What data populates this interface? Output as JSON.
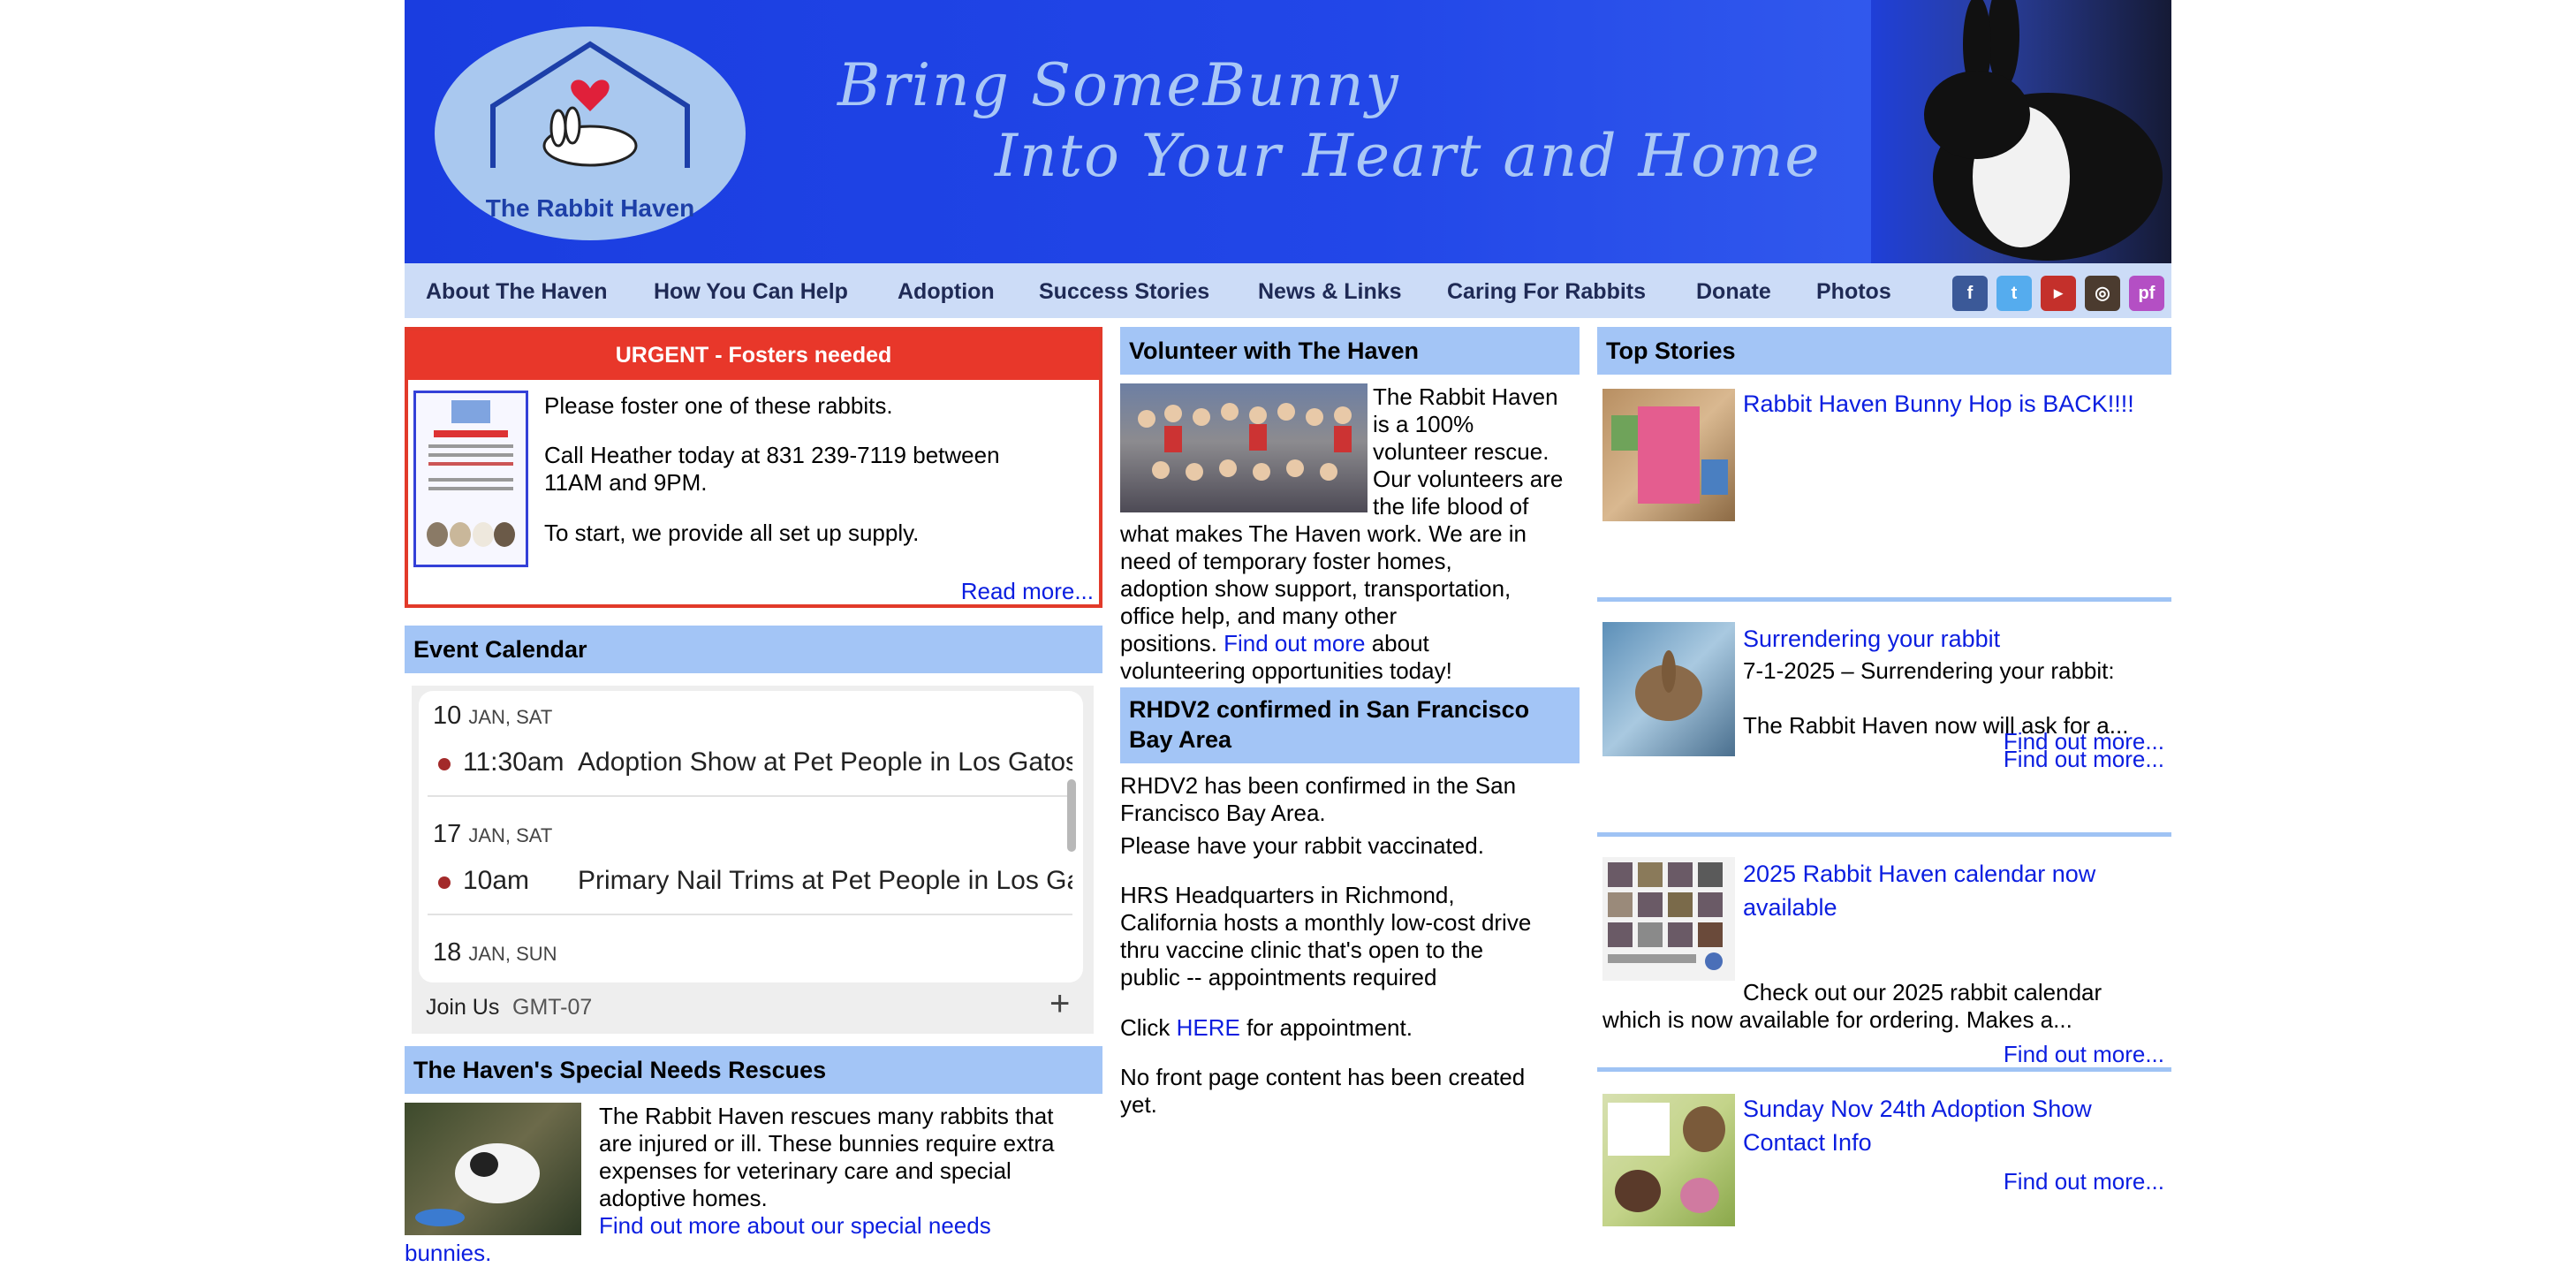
{
  "banner": {
    "logo_text": "The Rabbit Haven",
    "tagline_line1": "Bring SomeBunny",
    "tagline_line2": "Into Your Heart and Home"
  },
  "nav": {
    "items": [
      "About The Haven",
      "How You Can Help",
      "Adoption",
      "Success Stories",
      "News & Links",
      "Caring For Rabbits",
      "Donate",
      "Photos"
    ],
    "social": [
      "facebook-icon",
      "twitter-icon",
      "youtube-icon",
      "instagram-icon",
      "petfinder-icon"
    ]
  },
  "urgent": {
    "heading": "URGENT - Fosters needed",
    "p1": "Please foster one of these rabbits.",
    "p2a": "Call Heather today at 831 239-7119 between",
    "p2b": "11AM and 9PM.",
    "p3": "To start, we provide all set up supply.",
    "read_more": "Read more..."
  },
  "calendar": {
    "heading": "Event Calendar",
    "days": [
      {
        "day": "10",
        "dow": "JAN, SAT",
        "time": "11:30am",
        "title": "Adoption Show at Pet People in Los Gatos"
      },
      {
        "day": "17",
        "dow": "JAN, SAT",
        "time": "10am",
        "title": "Primary Nail Trims at Pet People in Los Gatos"
      },
      {
        "day": "18",
        "dow": "JAN, SUN"
      }
    ],
    "footer_label": "Join Us",
    "timezone": "GMT-07",
    "add_symbol": "+"
  },
  "special_needs": {
    "heading": "The Haven's Special Needs Rescues",
    "lines": [
      "The Rabbit Haven rescues many rabbits that",
      "are injured or ill. These bunnies require extra",
      "expenses for veterinary care and special",
      "adoptive homes."
    ],
    "link_part1": "Find out more about our special needs",
    "link_part2": "bunnies."
  },
  "volunteer": {
    "heading": "Volunteer with The Haven",
    "side_lines": [
      "The Rabbit Haven",
      "is a 100%",
      "volunteer rescue.",
      "Our volunteers are",
      "the life blood of"
    ],
    "full_lines": [
      "what makes The Haven work. We are in",
      "need of temporary foster homes,",
      "adoption show support, transportation,",
      "office help, and many other"
    ],
    "positions_prefix": "positions.",
    "find_out_more": "Find out more",
    "about_text": "about",
    "last_line": "volunteering opportunities today!"
  },
  "rhdv": {
    "heading_line1": "RHDV2 confirmed in San Francisco",
    "heading_line2": "Bay Area",
    "l1": "RHDV2 has been confirmed in the San",
    "l2": "Francisco Bay Area.",
    "l3": "Please have your rabbit vaccinated.",
    "l4": "HRS Headquarters in Richmond,",
    "l5": "California hosts a monthly low-cost drive",
    "l6": "thru vaccine clinic that's open to the",
    "l7": "public -- appointments required",
    "click_prefix": "Click",
    "here": "HERE",
    "click_suffix": "for appointment.",
    "l9": "No front page content has been created",
    "l10": "yet."
  },
  "top_stories": {
    "heading": "Top Stories",
    "s1": {
      "title": "Rabbit Haven Bunny Hop is BACK!!!!"
    },
    "s2": {
      "title": "Surrendering your rabbit",
      "l1": "7-1-2025 – Surrendering your rabbit:",
      "l2": "The Rabbit Haven now will ask for a...",
      "more1": "Find out more...",
      "more2": "Find out more..."
    },
    "s3": {
      "title1": "2025 Rabbit Haven calendar now",
      "title2": "available",
      "l1": "Check out our 2025 rabbit calendar",
      "l2": "which is now available for ordering. Makes a...",
      "more": "Find out more..."
    },
    "s4": {
      "title1": "Sunday Nov 24th Adoption Show",
      "title2": "Contact Info",
      "more": "Find out more..."
    }
  },
  "colors": {
    "banner_blue": "#2247e8",
    "nav_bg": "#ccdcf7",
    "header_bar": "#a3c5f6",
    "urgent_red": "#e8372a",
    "link": "#0b1ee0"
  }
}
